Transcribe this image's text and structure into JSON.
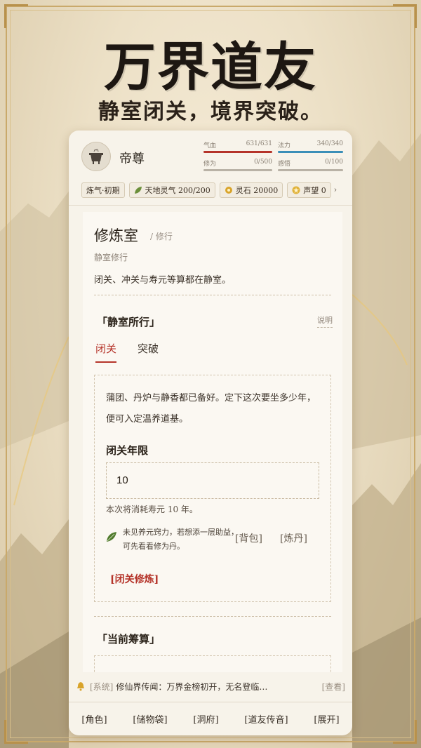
{
  "banner": {
    "title": "万界道友",
    "subtitle": "静室闭关，境界突破。"
  },
  "player": {
    "name": "帝尊",
    "avatar_icon": "cauldron-icon",
    "stats": [
      {
        "label": "气血",
        "value": "631/631",
        "current": 631,
        "max": 631,
        "color": "#b5342a"
      },
      {
        "label": "法力",
        "value": "340/340",
        "current": 340,
        "max": 340,
        "color": "#3b8fb8"
      },
      {
        "label": "修为",
        "value": "0/500",
        "current": 0,
        "max": 500,
        "color": "#b9b2a6"
      },
      {
        "label": "感悟",
        "value": "0/100",
        "current": 0,
        "max": 100,
        "color": "#b9b2a6"
      }
    ]
  },
  "resources": [
    {
      "label": "炼气·初期",
      "icon": ""
    },
    {
      "label": "天地灵气 200/200",
      "icon": "leaf-icon"
    },
    {
      "label": "灵石 20000",
      "icon": "spirit-stone-icon"
    },
    {
      "label": "声望 0",
      "icon": "star-icon"
    }
  ],
  "page": {
    "title": "修炼室",
    "breadcrumb": "/ 修行",
    "subtitle": "静室修行",
    "description": "闭关、冲关与寿元等算都在静室。"
  },
  "section": {
    "title": "「静室所行」",
    "explain": "说明",
    "tabs": [
      "闭关",
      "突破"
    ]
  },
  "retreat": {
    "intro": "蒲团、丹炉与静香都已备好。定下这次要坐多少年，便可入定温养道基。",
    "field_label": "闭关年限",
    "field_value": "10",
    "cost": "本次将消耗寿元 10 年。",
    "hint": "未见养元窍力，若想添一层助益，可先看看修为丹。",
    "link_bag": "[背包]",
    "link_alchemy": "[炼丹]",
    "action": "[闭关修炼]"
  },
  "section2": {
    "title": "「当前筹算」"
  },
  "notice": {
    "tag": "[系统]",
    "message": "修仙界传闻：万界金榜初开，无名登临…",
    "more": "[查看]"
  },
  "nav": [
    "[角色]",
    "[储物袋]",
    "[洞府]",
    "[道友传音]",
    "[展开]"
  ]
}
